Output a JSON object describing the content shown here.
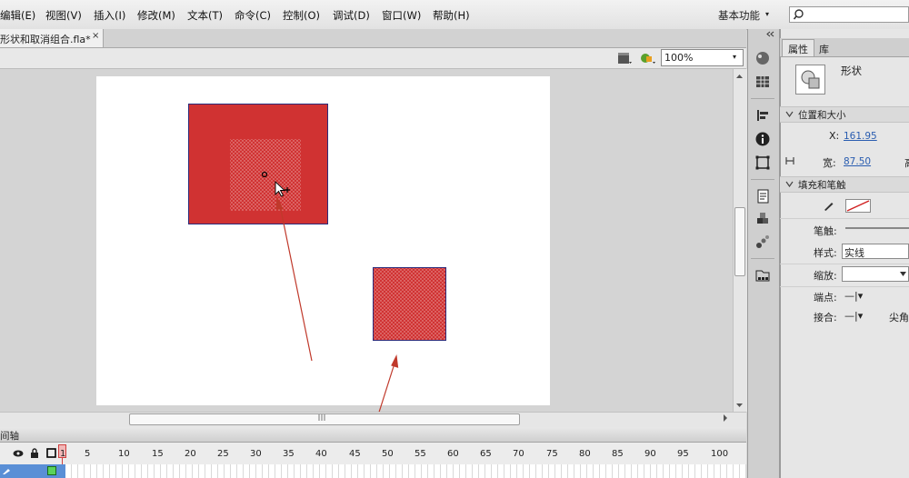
{
  "menubar": {
    "items": [
      "编辑(E)",
      "视图(V)",
      "插入(I)",
      "修改(M)",
      "文本(T)",
      "命令(C)",
      "控制(O)",
      "调试(D)",
      "窗口(W)",
      "帮助(H)"
    ],
    "workspace": "基本功能",
    "workspace_arrow": "▾"
  },
  "document": {
    "tab_label": "形状和取消组合.fla*",
    "close_glyph": "×"
  },
  "editbar": {
    "zoom": "100%",
    "zoom_arrow": "▾"
  },
  "timeline": {
    "title": "间轴",
    "ruler": [
      "1",
      "5",
      "10",
      "15",
      "20",
      "25",
      "30",
      "35",
      "40",
      "45",
      "50",
      "55",
      "60",
      "65",
      "70",
      "75",
      "80",
      "85",
      "90",
      "95",
      "100"
    ]
  },
  "properties": {
    "tab_properties": "属性",
    "tab_library": "库",
    "object_type": "形状",
    "section_position": "位置和大小",
    "x_label": "X:",
    "x_value": "161.95",
    "width_label": "宽:",
    "width_value": "87.50",
    "height_label_partial": "高",
    "section_fill_stroke": "填充和笔触",
    "stroke_label": "笔触:",
    "style_label": "样式:",
    "style_value": "实线",
    "scale_label": "缩放:",
    "cap_label": "端点:",
    "join_label": "接合:",
    "cap_glyph": "—|▾",
    "join_glyph": "—|▾",
    "miter_label_partial": "尖角"
  },
  "colors": {
    "shape_fill": "#d03232",
    "selection_dots": "#e8a0a0",
    "annotation_arrow": "#c0392b",
    "accent_blue": "#2a5db0"
  }
}
